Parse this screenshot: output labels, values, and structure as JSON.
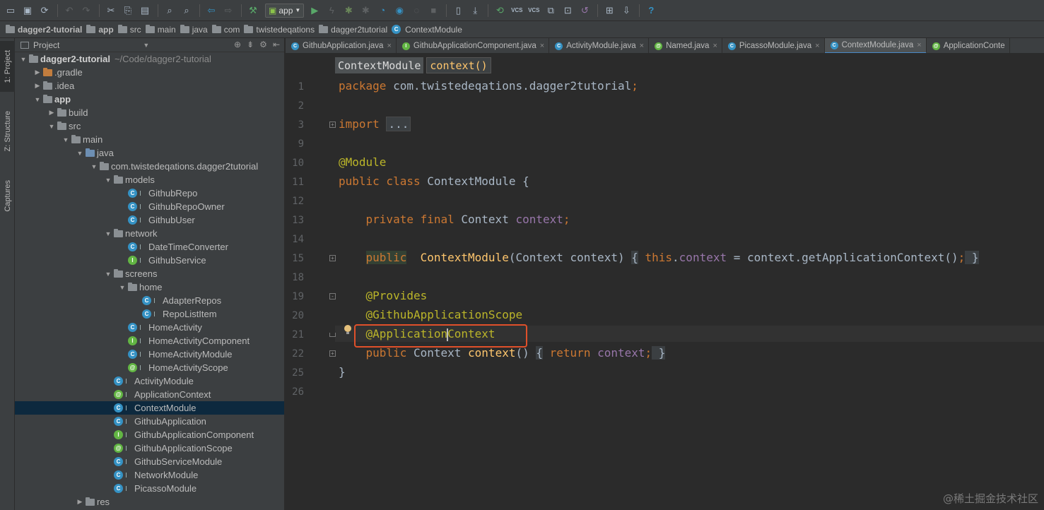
{
  "toolbar": {
    "run_config": "app",
    "vcs_label": "VCS",
    "help": "?"
  },
  "breadcrumb": [
    {
      "label": "dagger2-tutorial",
      "bold": true,
      "icon": "folder-icon"
    },
    {
      "label": "app",
      "bold": true,
      "icon": "folder-icon"
    },
    {
      "label": "src",
      "bold": false,
      "icon": "folder-icon"
    },
    {
      "label": "main",
      "bold": false,
      "icon": "folder-icon"
    },
    {
      "label": "java",
      "bold": false,
      "icon": "folder-icon"
    },
    {
      "label": "com",
      "bold": false,
      "icon": "package-icon"
    },
    {
      "label": "twistedeqations",
      "bold": false,
      "icon": "package-icon"
    },
    {
      "label": "dagger2tutorial",
      "bold": false,
      "icon": "package-icon"
    },
    {
      "label": "ContextModule",
      "bold": false,
      "icon": "class-icon"
    }
  ],
  "side_strip": {
    "project": "1: Project",
    "structure": "Z: Structure",
    "captures": "Captures"
  },
  "project_panel": {
    "title": "Project",
    "root_label": "dagger2-tutorial",
    "root_path": "~/Code/dagger2-tutorial",
    "tree": [
      {
        "label": "dagger2-tutorial",
        "depth": 0,
        "arrow": "open",
        "icon": "folder",
        "bold": true
      },
      {
        "label": ".gradle",
        "depth": 1,
        "arrow": "closed",
        "icon": "folder-orange"
      },
      {
        "label": ".idea",
        "depth": 1,
        "arrow": "closed",
        "icon": "folder"
      },
      {
        "label": "app",
        "depth": 1,
        "arrow": "open",
        "icon": "folder",
        "bold": true
      },
      {
        "label": "build",
        "depth": 2,
        "arrow": "closed",
        "icon": "folder"
      },
      {
        "label": "src",
        "depth": 2,
        "arrow": "open",
        "icon": "folder"
      },
      {
        "label": "main",
        "depth": 3,
        "arrow": "open",
        "icon": "folder"
      },
      {
        "label": "java",
        "depth": 4,
        "arrow": "open",
        "icon": "folder-blue"
      },
      {
        "label": "com.twistedeqations.dagger2tutorial",
        "depth": 5,
        "arrow": "open",
        "icon": "package"
      },
      {
        "label": "models",
        "depth": 6,
        "arrow": "open",
        "icon": "package"
      },
      {
        "label": "GithubRepo",
        "depth": 7,
        "arrow": "none",
        "icon": "class"
      },
      {
        "label": "GithubRepoOwner",
        "depth": 7,
        "arrow": "none",
        "icon": "class"
      },
      {
        "label": "GithubUser",
        "depth": 7,
        "arrow": "none",
        "icon": "class"
      },
      {
        "label": "network",
        "depth": 6,
        "arrow": "open",
        "icon": "package"
      },
      {
        "label": "DateTimeConverter",
        "depth": 7,
        "arrow": "none",
        "icon": "class"
      },
      {
        "label": "GithubService",
        "depth": 7,
        "arrow": "none",
        "icon": "interface"
      },
      {
        "label": "screens",
        "depth": 6,
        "arrow": "open",
        "icon": "package"
      },
      {
        "label": "home",
        "depth": 7,
        "arrow": "open",
        "icon": "package"
      },
      {
        "label": "AdapterRepos",
        "depth": 8,
        "arrow": "none",
        "icon": "class"
      },
      {
        "label": "RepoListItem",
        "depth": 8,
        "arrow": "none",
        "icon": "class"
      },
      {
        "label": "HomeActivity",
        "depth": 7,
        "arrow": "none",
        "icon": "class"
      },
      {
        "label": "HomeActivityComponent",
        "depth": 7,
        "arrow": "none",
        "icon": "interface"
      },
      {
        "label": "HomeActivityModule",
        "depth": 7,
        "arrow": "none",
        "icon": "class"
      },
      {
        "label": "HomeActivityScope",
        "depth": 7,
        "arrow": "none",
        "icon": "annotation"
      },
      {
        "label": "ActivityModule",
        "depth": 6,
        "arrow": "none",
        "icon": "class"
      },
      {
        "label": "ApplicationContext",
        "depth": 6,
        "arrow": "none",
        "icon": "annotation"
      },
      {
        "label": "ContextModule",
        "depth": 6,
        "arrow": "none",
        "icon": "class",
        "selected": true
      },
      {
        "label": "GithubApplication",
        "depth": 6,
        "arrow": "none",
        "icon": "class"
      },
      {
        "label": "GithubApplicationComponent",
        "depth": 6,
        "arrow": "none",
        "icon": "interface"
      },
      {
        "label": "GithubApplicationScope",
        "depth": 6,
        "arrow": "none",
        "icon": "annotation"
      },
      {
        "label": "GithubServiceModule",
        "depth": 6,
        "arrow": "none",
        "icon": "class"
      },
      {
        "label": "NetworkModule",
        "depth": 6,
        "arrow": "none",
        "icon": "class"
      },
      {
        "label": "PicassoModule",
        "depth": 6,
        "arrow": "none",
        "icon": "class"
      },
      {
        "label": "res",
        "depth": 4,
        "arrow": "closed",
        "icon": "folder"
      }
    ]
  },
  "editor": {
    "tabs": [
      {
        "label": "GithubApplication.java",
        "icon": "c",
        "active": false
      },
      {
        "label": "GithubApplicationComponent.java",
        "icon": "i",
        "active": false
      },
      {
        "label": "ActivityModule.java",
        "icon": "c",
        "active": false
      },
      {
        "label": "Named.java",
        "icon": "a",
        "active": false
      },
      {
        "label": "PicassoModule.java",
        "icon": "c",
        "active": false
      },
      {
        "label": "ContextModule.java",
        "icon": "c",
        "active": true
      },
      {
        "label": "ApplicationConte",
        "icon": "a",
        "active": false
      }
    ],
    "nav_class": "ContextModule",
    "nav_method": "context()",
    "lines": [
      {
        "no": "1",
        "tokens": [
          [
            "kw",
            "package "
          ],
          [
            "",
            "com.twistedeqations.dagger2tutorial"
          ],
          [
            "kw",
            ";"
          ]
        ]
      },
      {
        "no": "2",
        "tokens": []
      },
      {
        "no": "3",
        "tokens": [
          [
            "kw",
            "import "
          ],
          [
            "chip",
            "..."
          ]
        ],
        "fold": "plus"
      },
      {
        "no": "9",
        "tokens": []
      },
      {
        "no": "10",
        "tokens": [
          [
            "ann",
            "@Module"
          ]
        ]
      },
      {
        "no": "11",
        "tokens": [
          [
            "kw",
            "public class "
          ],
          [
            "",
            "ContextModule {"
          ]
        ]
      },
      {
        "no": "12",
        "tokens": []
      },
      {
        "no": "13",
        "tokens": [
          [
            "",
            "    "
          ],
          [
            "kw",
            "private final "
          ],
          [
            "",
            "Context "
          ],
          [
            "fld",
            "context"
          ],
          [
            "kw",
            ";"
          ]
        ]
      },
      {
        "no": "14",
        "tokens": []
      },
      {
        "no": "15",
        "tokens": [
          [
            "",
            "    "
          ],
          [
            "kwhl",
            "public"
          ],
          [
            "",
            "  "
          ],
          [
            "fn",
            "ContextModule"
          ],
          [
            "",
            "(Context context) "
          ],
          [
            "brace",
            "{"
          ],
          [
            "",
            " "
          ],
          [
            "kw",
            "this"
          ],
          [
            "",
            "."
          ],
          [
            "fld",
            "context"
          ],
          [
            "",
            " = context.getApplicationContext()"
          ],
          [
            "kw",
            ";"
          ],
          [
            "brace",
            " }"
          ]
        ],
        "fold": "plus"
      },
      {
        "no": "18",
        "tokens": []
      },
      {
        "no": "19",
        "tokens": [
          [
            "",
            "    "
          ],
          [
            "ann",
            "@Provides"
          ]
        ],
        "fold": "start"
      },
      {
        "no": "20",
        "tokens": [
          [
            "",
            "    "
          ],
          [
            "ann",
            "@GithubApplicationScope"
          ]
        ]
      },
      {
        "no": "21",
        "tokens": [
          [
            "",
            "    "
          ],
          [
            "ann",
            "@Application"
          ],
          [
            "caret",
            ""
          ],
          [
            "ann",
            "Context"
          ]
        ],
        "fold": "end",
        "current": true
      },
      {
        "no": "22",
        "tokens": [
          [
            "",
            "    "
          ],
          [
            "kw",
            "public "
          ],
          [
            "",
            "Context "
          ],
          [
            "fn",
            "context"
          ],
          [
            "",
            "() "
          ],
          [
            "brace",
            "{"
          ],
          [
            "kw",
            " return "
          ],
          [
            "fld",
            "context"
          ],
          [
            "kw",
            ";"
          ],
          [
            "brace",
            " }"
          ]
        ],
        "fold": "plus"
      },
      {
        "no": "25",
        "tokens": [
          [
            "",
            "}"
          ]
        ]
      },
      {
        "no": "26",
        "tokens": []
      }
    ]
  },
  "watermark": "@稀土掘金技术社区",
  "colors": {
    "keyword": "#cc7832",
    "annotation": "#bbb529",
    "field": "#9876aa",
    "method": "#ffc66d",
    "highlight_box": "#e0502a",
    "selection": "#0d293e"
  }
}
